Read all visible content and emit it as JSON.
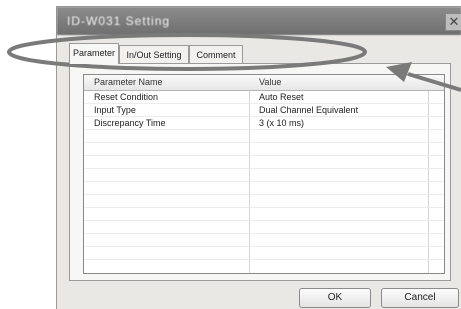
{
  "window": {
    "title": "ID-W031 Setting"
  },
  "tabs": [
    {
      "label": "Parameter"
    },
    {
      "label": "In/Out Setting"
    },
    {
      "label": "Comment"
    }
  ],
  "table": {
    "headers": {
      "name": "Parameter Name",
      "value": "Value"
    },
    "rows": [
      {
        "name": "Reset Condition",
        "value": "Auto Reset"
      },
      {
        "name": "Input Type",
        "value": "Dual Channel Equivalent"
      },
      {
        "name": "Discrepancy Time",
        "value": "3 (x 10 ms)"
      }
    ]
  },
  "buttons": {
    "ok": "OK",
    "cancel": "Cancel"
  },
  "colors": {
    "annotation": "#7a7a7a",
    "titlebar": "#7d7d7d"
  }
}
